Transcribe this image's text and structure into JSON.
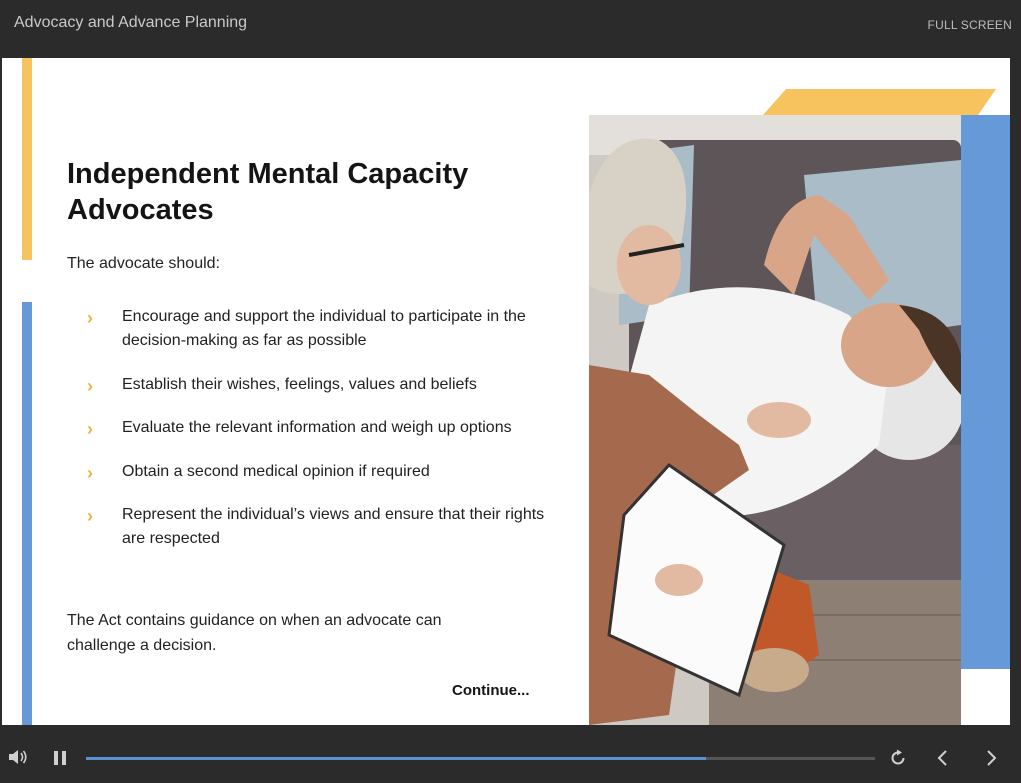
{
  "app": {
    "course_title": "Advocacy and Advance Planning",
    "fullscreen_label": "FULL SCREEN"
  },
  "slide": {
    "heading": "Independent Mental Capacity Advocates",
    "intro": "The advocate should:",
    "bullets": [
      "Encourage and support the individual to participate in the decision-making as far as possible",
      "Establish their wishes, feelings, values and beliefs",
      "Evaluate the relevant information and weigh up options",
      "Obtain a second medical opinion if required",
      "Represent the individual’s views and ensure that their rights are respected"
    ],
    "outro": "The Act contains guidance on when an advocate can challenge a decision.",
    "continue_label": "Continue..."
  },
  "player": {
    "progress_fraction": 0.786,
    "icons": [
      "volume-icon",
      "pause-icon",
      "replay-icon",
      "previous-icon",
      "next-icon"
    ]
  },
  "colors": {
    "accent_yellow": "#f7c35e",
    "accent_blue": "#6699d8",
    "chevron": "#f0b23f",
    "progress": "#5b8fd6",
    "chrome": "#2b2b2b"
  }
}
